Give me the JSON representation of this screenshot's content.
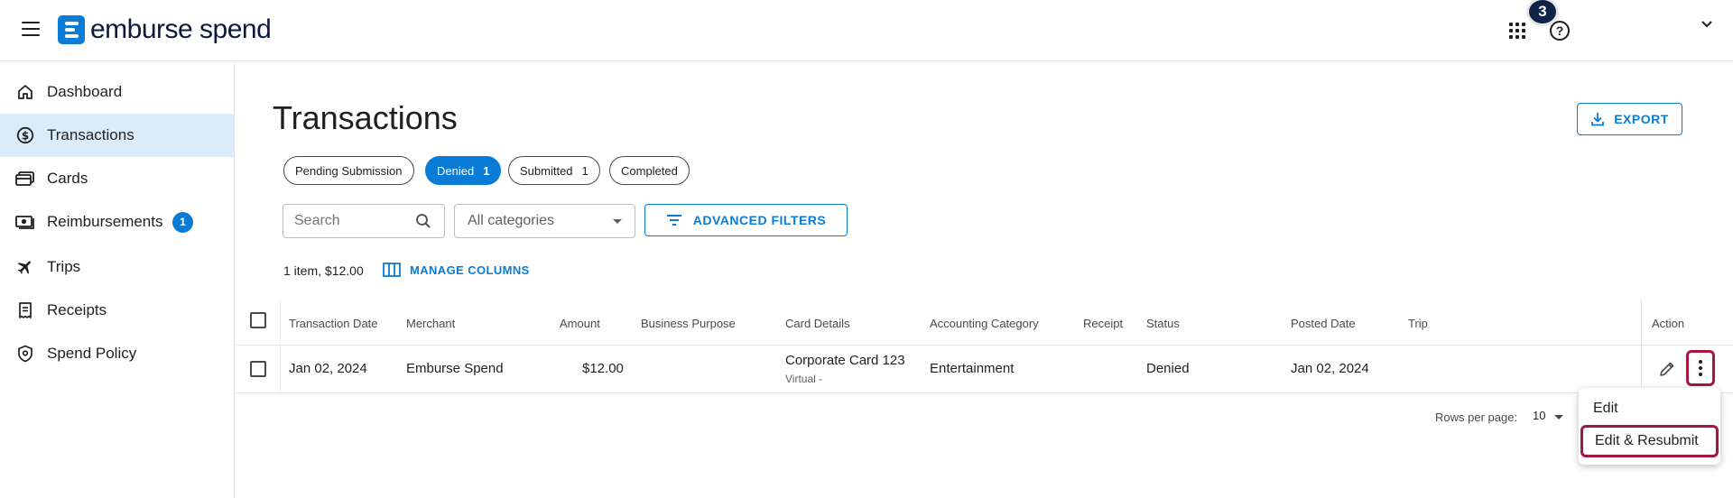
{
  "topbar": {
    "logo_text": "emburse spend",
    "notification_count": "3",
    "help_glyph": "?",
    "icons": [
      "menu-icon",
      "apps-grid-icon",
      "help-icon",
      "chevron-down-icon"
    ]
  },
  "sidebar": {
    "items": [
      {
        "label": "Dashboard",
        "icon": "home-icon"
      },
      {
        "label": "Transactions",
        "icon": "dollar-circle-icon",
        "active": true
      },
      {
        "label": "Cards",
        "icon": "cards-icon"
      },
      {
        "label": "Reimbursements",
        "icon": "cash-icon",
        "badge": "1"
      },
      {
        "label": "Trips",
        "icon": "airplane-icon"
      },
      {
        "label": "Receipts",
        "icon": "receipt-icon"
      },
      {
        "label": "Spend Policy",
        "icon": "shield-icon"
      }
    ]
  },
  "main": {
    "title": "Transactions",
    "export_label": "EXPORT",
    "chips": [
      {
        "label": "Pending Submission",
        "count": ""
      },
      {
        "label": "Denied",
        "count": "1",
        "selected": true
      },
      {
        "label": "Submitted",
        "count": "1"
      },
      {
        "label": "Completed",
        "count": ""
      }
    ],
    "search_placeholder": "Search",
    "category_value": "All categories",
    "advanced_filters_label": "ADVANCED FILTERS",
    "summary": "1 item, $12.00",
    "manage_columns_label": "MANAGE COLUMNS"
  },
  "table": {
    "headers": [
      "Transaction Date",
      "Merchant",
      "Amount",
      "Business Purpose",
      "Card Details",
      "Accounting Category",
      "Receipt",
      "Status",
      "Posted Date",
      "Trip",
      "Action"
    ],
    "rows": [
      {
        "transaction_date": "Jan 02, 2024",
        "merchant": "Emburse Spend",
        "amount": "$12.00",
        "business_purpose": "",
        "card_name": "Corporate Card 123",
        "card_type": "Virtual -",
        "accounting_category": "Entertainment",
        "receipt": "",
        "status": "Denied",
        "posted_date": "Jan 02, 2024",
        "trip": ""
      }
    ]
  },
  "pagination": {
    "rows_per_page_label": "Rows per page:",
    "rows_per_page_value": "10"
  },
  "action_menu": {
    "items": [
      "Edit",
      "Edit & Resubmit"
    ]
  },
  "colors": {
    "primary": "#0a7cd6",
    "active_nav_bg": "#dcebf9",
    "highlight_border": "#a4163e",
    "badge_dark": "#0f2447"
  }
}
